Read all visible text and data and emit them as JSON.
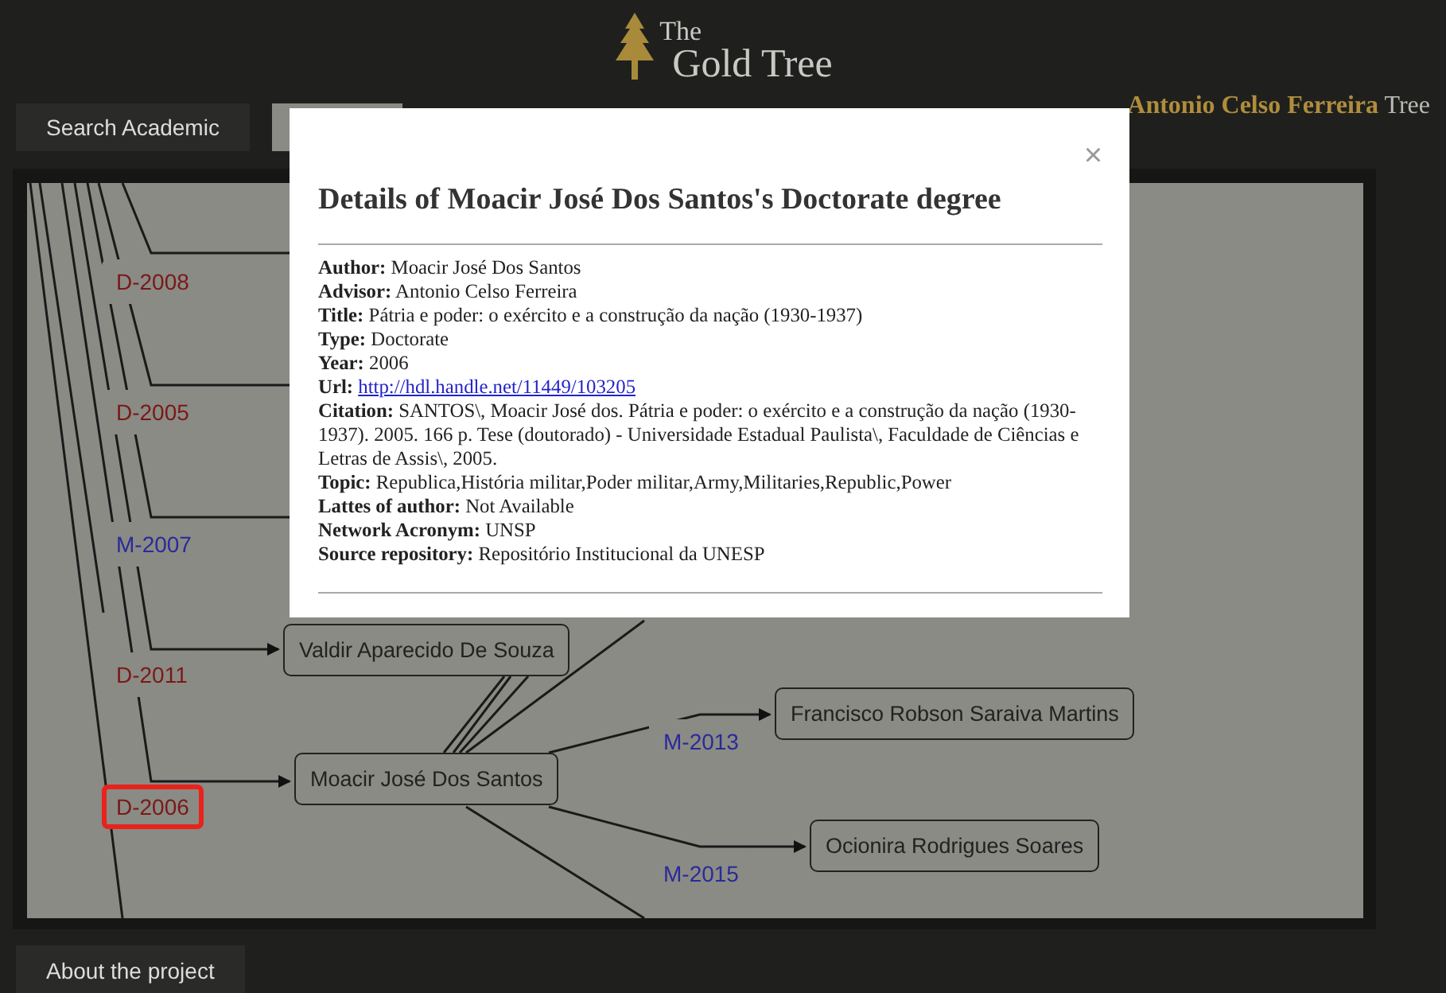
{
  "header": {
    "logo_small": "The",
    "logo_large": "Gold Tree",
    "tree_owner": "Antonio Celso Ferreira",
    "tree_word": "Tree"
  },
  "tabs": [
    {
      "label": "Search Academic",
      "selected": false
    },
    {
      "selected": true
    }
  ],
  "tree": {
    "nodes": [
      {
        "name": "Valdir Aparecido De Souza"
      },
      {
        "name": "Moacir José Dos Santos"
      },
      {
        "name": "Francisco Robson Saraiva Martins"
      },
      {
        "name": "Ocionira Rodrigues Soares"
      }
    ],
    "edge_labels": [
      {
        "text": "D-2008",
        "kind": "doctorate",
        "highlighted": false
      },
      {
        "text": "D-2005",
        "kind": "doctorate",
        "highlighted": false
      },
      {
        "text": "M-2007",
        "kind": "masters",
        "highlighted": false
      },
      {
        "text": "D-2011",
        "kind": "doctorate",
        "highlighted": false
      },
      {
        "text": "D-2006",
        "kind": "doctorate",
        "highlighted": true
      },
      {
        "text": "M-2013",
        "kind": "masters",
        "highlighted": false
      },
      {
        "text": "M-2015",
        "kind": "masters",
        "highlighted": false
      }
    ]
  },
  "modal": {
    "close": "×",
    "title": "Details of Moacir José Dos Santos's Doctorate degree",
    "fields": [
      {
        "label": "Author:",
        "value": "Moacir José Dos Santos",
        "kind": "text"
      },
      {
        "label": "Advisor:",
        "value": "Antonio Celso Ferreira",
        "kind": "text"
      },
      {
        "label": "Title:",
        "value": "Pátria e poder: o exército e a construção da nação (1930-1937)",
        "kind": "text"
      },
      {
        "label": "Type:",
        "value": "Doctorate",
        "kind": "text"
      },
      {
        "label": "Year:",
        "value": "2006",
        "kind": "text"
      },
      {
        "label": "Url:",
        "value": "http://hdl.handle.net/11449/103205",
        "kind": "link"
      },
      {
        "label": "Citation:",
        "value": "SANTOS\\, Moacir José dos. Pátria e poder: o exército e a construção da nação (1930-1937). 2005. 166 p. Tese (doutorado) - Universidade Estadual Paulista\\, Faculdade de Ciências e Letras de Assis\\, 2005.",
        "kind": "text"
      },
      {
        "label": "Topic:",
        "value": "Republica,História militar,Poder militar,Army,Militaries,Republic,Power",
        "kind": "text"
      },
      {
        "label": "Lattes of author:",
        "value": "Not Available",
        "kind": "text"
      },
      {
        "label": "Network Acronym:",
        "value": "UNSP",
        "kind": "text"
      },
      {
        "label": "Source repository:",
        "value": "Repositório Institucional da UNESP",
        "kind": "text"
      }
    ]
  },
  "footer": {
    "button": "About the project"
  }
}
